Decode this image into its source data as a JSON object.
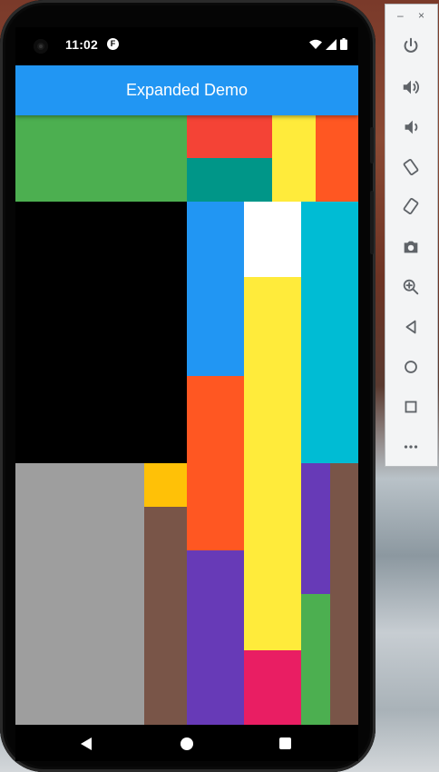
{
  "status_bar": {
    "time": "11:02",
    "app_badge": "F"
  },
  "app_bar": {
    "title": "Expanded Demo"
  },
  "colors": {
    "app_bar": "#2196f3",
    "green": "#4caf50",
    "red": "#f44336",
    "teal": "#009688",
    "yellow": "#ffeb3b",
    "deep_orange": "#ff5722",
    "black": "#000000",
    "blue": "#2196f3",
    "white": "#ffffff",
    "cyan": "#00bcd4",
    "grey": "#9e9e9e",
    "amber": "#ffc107",
    "brown": "#795548",
    "deep_purple": "#673ab7",
    "pink": "#e91e63"
  },
  "emulator_toolbar": {
    "buttons": [
      "power-icon",
      "volume-up-icon",
      "volume-down-icon",
      "rotate-left-icon",
      "rotate-right-icon",
      "camera-icon",
      "zoom-icon",
      "back-icon",
      "home-icon",
      "overview-icon",
      "more-icon"
    ]
  }
}
